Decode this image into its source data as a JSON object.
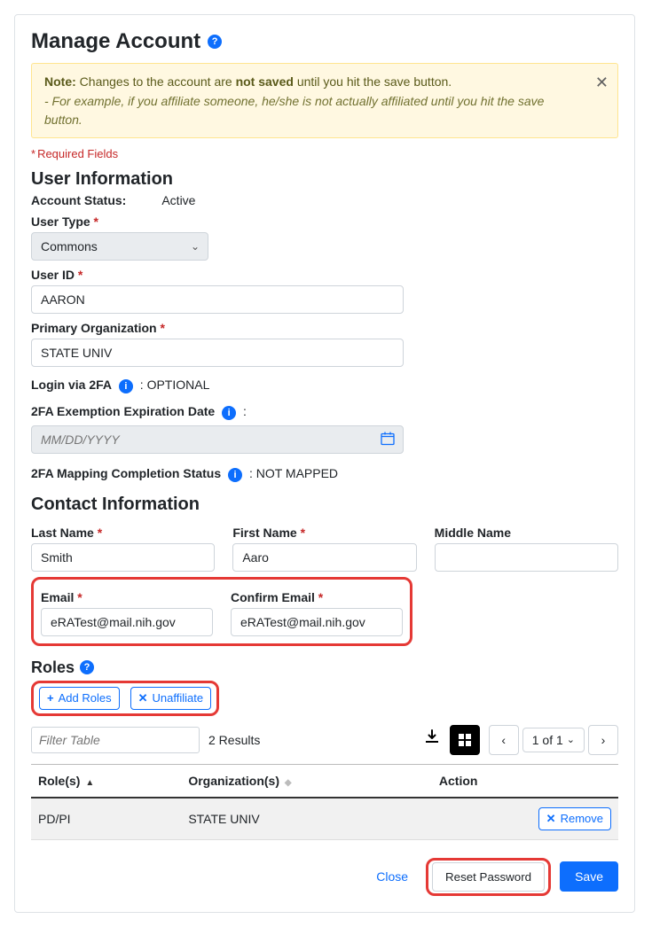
{
  "header": {
    "title": "Manage Account"
  },
  "alert": {
    "lead": "Note:",
    "text_before": "Changes to the account are",
    "strong": "not saved",
    "text_after": "until you hit the save button.",
    "example": "- For example, if you affiliate someone, he/she is not actually affiliated until you hit the save button."
  },
  "required_note": "Required Fields",
  "sections": {
    "user_info": "User Information",
    "contact_info": "Contact Information",
    "roles": "Roles"
  },
  "user": {
    "account_status_label": "Account Status:",
    "account_status": "Active",
    "user_type_label": "User Type",
    "user_type": "Commons",
    "user_id_label": "User ID",
    "user_id": "AARON",
    "primary_org_label": "Primary Organization",
    "primary_org": "STATE UNIV",
    "login_2fa_label": "Login via 2FA",
    "login_2fa_status": ": OPTIONAL",
    "exemption_label": "2FA Exemption Expiration Date",
    "exemption_colon": ":",
    "exemption_placeholder": "MM/DD/YYYY",
    "mapping_label": "2FA Mapping Completion Status",
    "mapping_status": ": NOT MAPPED"
  },
  "contact": {
    "last_name_label": "Last Name",
    "last_name": "Smith",
    "first_name_label": "First Name",
    "first_name": "Aaro",
    "middle_name_label": "Middle Name",
    "middle_name": "",
    "email_label": "Email",
    "email": "eRATest@mail.nih.gov",
    "confirm_email_label": "Confirm Email",
    "confirm_email": "eRATest@mail.nih.gov"
  },
  "roles": {
    "add_label": "Add Roles",
    "unaffiliate_label": "Unaffiliate",
    "filter_placeholder": "Filter Table",
    "results": "2 Results",
    "page_label": "1 of 1",
    "headers": {
      "roles": "Role(s)",
      "orgs": "Organization(s)",
      "action": "Action"
    },
    "rows": [
      {
        "role": "PD/PI",
        "org": "STATE UNIV",
        "remove": "Remove"
      }
    ]
  },
  "footer": {
    "close": "Close",
    "reset": "Reset Password",
    "save": "Save"
  }
}
